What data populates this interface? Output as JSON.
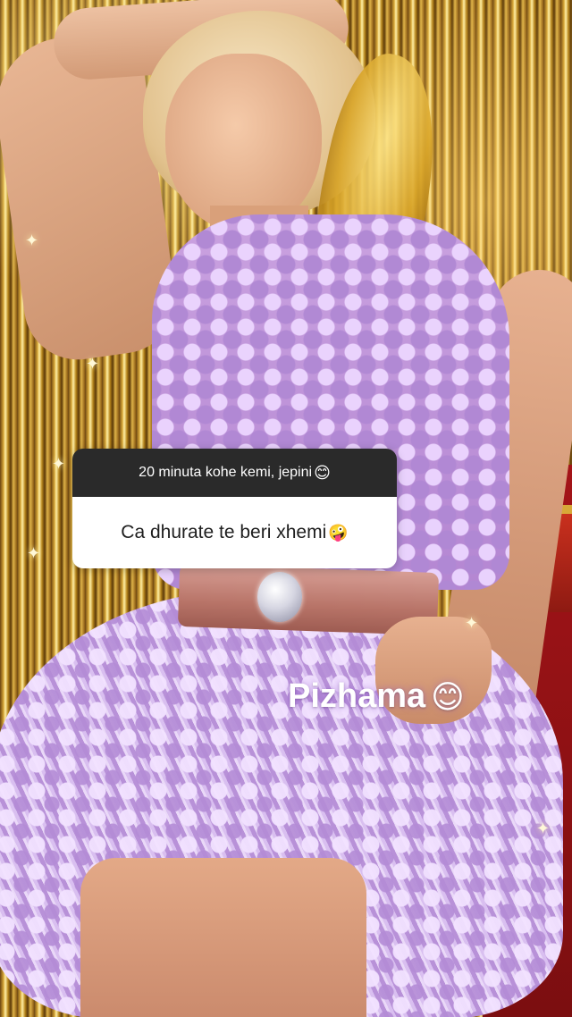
{
  "story": {
    "question_sticker": {
      "header_text": "20 minuta kohe kemi, jepini",
      "header_emoji": "😊",
      "question_text": "Ca dhurate te beri xhemi",
      "question_emoji": "🤪"
    },
    "answer": {
      "text": "Pizhama",
      "emoji": "😊"
    }
  },
  "colors": {
    "sticker_header_bg": "#2a2a2a",
    "sticker_body_bg": "#ffffff",
    "answer_text": "#ffffff"
  }
}
